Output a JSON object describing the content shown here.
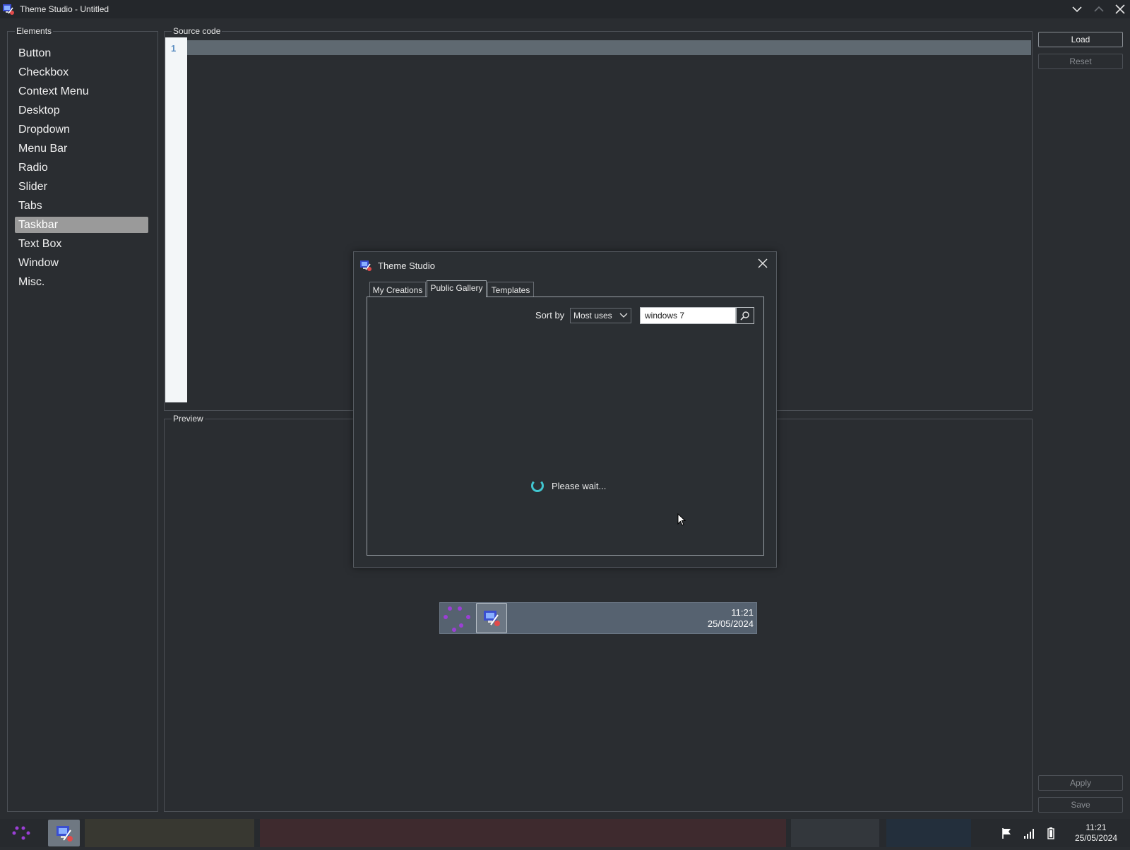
{
  "window": {
    "title": "Theme Studio - Untitled"
  },
  "elements_panel": {
    "label": "Elements",
    "items": [
      {
        "label": "Button"
      },
      {
        "label": "Checkbox"
      },
      {
        "label": "Context Menu"
      },
      {
        "label": "Desktop"
      },
      {
        "label": "Dropdown"
      },
      {
        "label": "Menu Bar"
      },
      {
        "label": "Radio"
      },
      {
        "label": "Slider"
      },
      {
        "label": "Tabs"
      },
      {
        "label": "Taskbar",
        "selected": true
      },
      {
        "label": "Text Box"
      },
      {
        "label": "Window"
      },
      {
        "label": "Misc."
      }
    ]
  },
  "source_panel": {
    "label": "Source code",
    "line_number": "1"
  },
  "preview_panel": {
    "label": "Preview",
    "taskbar": {
      "time": "11:21",
      "date": "25/05/2024"
    }
  },
  "side_buttons": {
    "load": "Load",
    "reset": "Reset",
    "apply": "Apply",
    "save": "Save"
  },
  "dialog": {
    "title": "Theme Studio",
    "tabs": [
      {
        "label": "My Creations"
      },
      {
        "label": "Public Gallery",
        "active": true
      },
      {
        "label": "Templates"
      }
    ],
    "sort_label": "Sort by",
    "sort_value": "Most uses",
    "search_value": "windows 7",
    "status": "Please wait..."
  },
  "system_taskbar": {
    "time": "11:21",
    "date": "25/05/2024"
  },
  "colors": {
    "background": "#2a2d31",
    "accent_spinner": "#41c7d1",
    "selection": "#9a9a9a",
    "start_purple": "#9b3fd6"
  }
}
